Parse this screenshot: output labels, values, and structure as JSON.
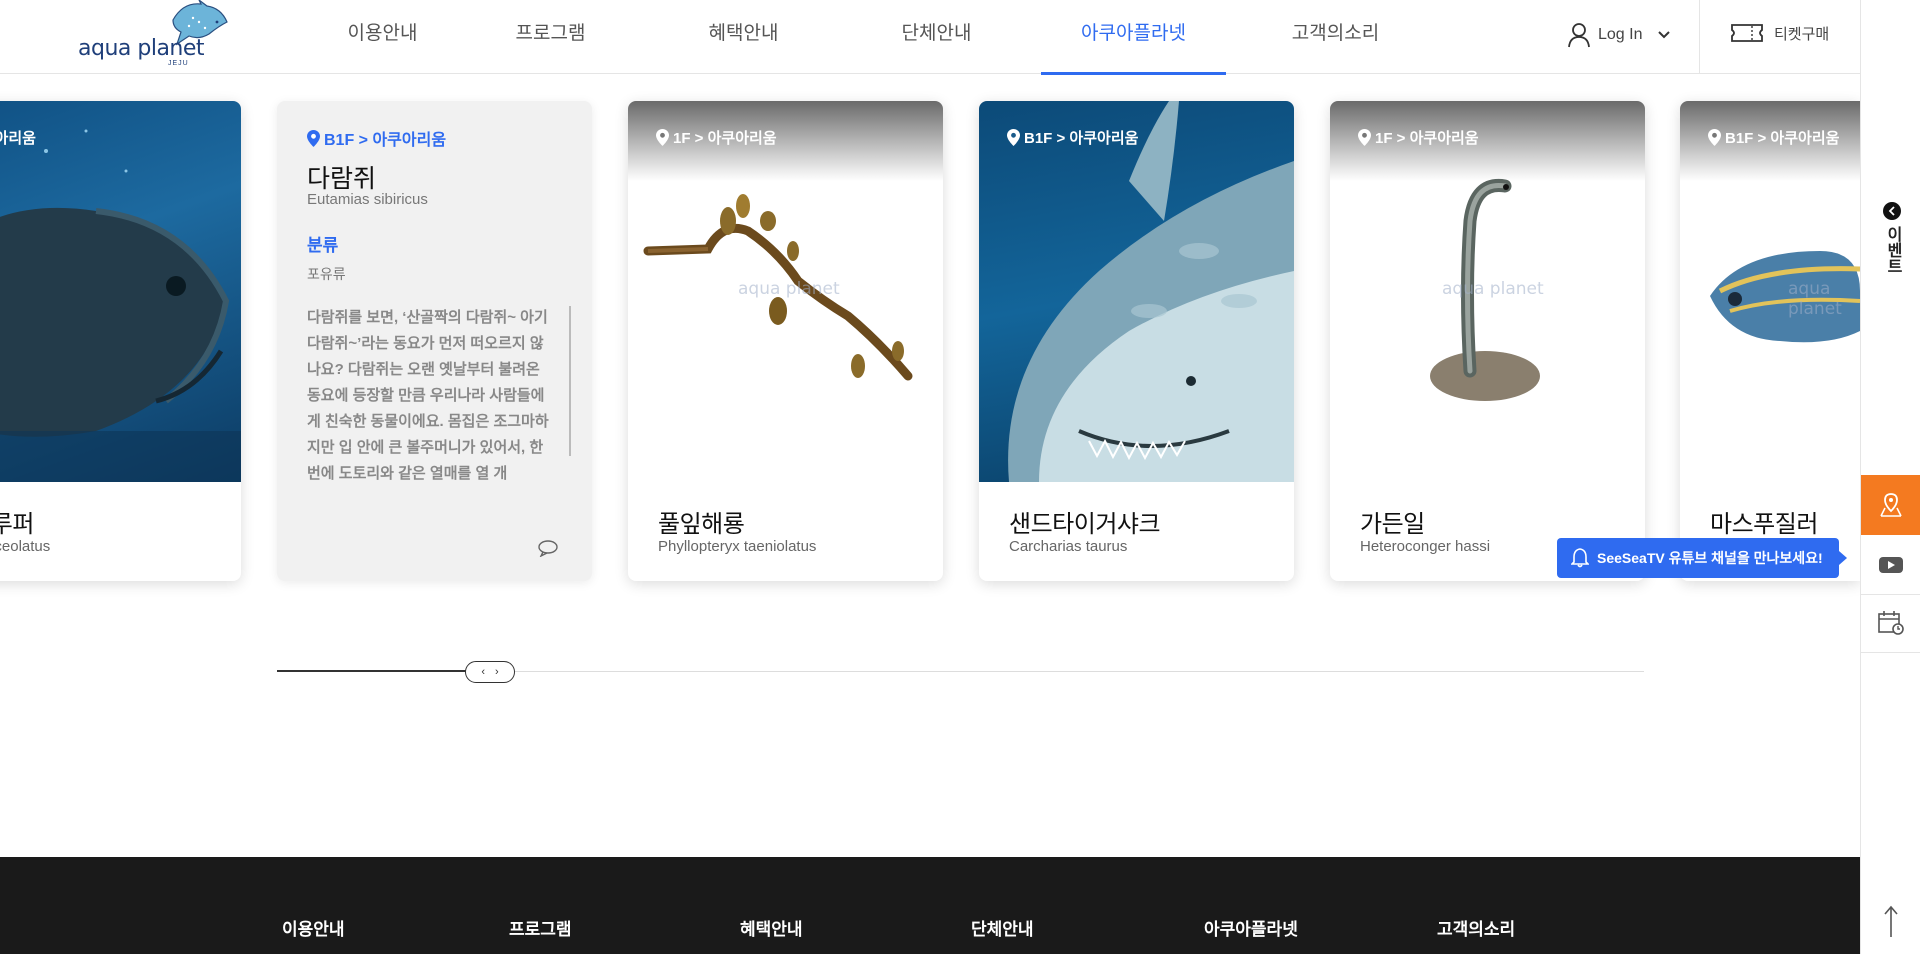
{
  "header": {
    "logo": {
      "text": "aqua planet",
      "sub": "JEJU"
    },
    "nav": [
      {
        "label": "이용안내"
      },
      {
        "label": "프로그램"
      },
      {
        "label": "혜택안내"
      },
      {
        "label": "단체안내"
      },
      {
        "label": "아쿠아플라넷",
        "active": true
      },
      {
        "label": "고객의소리"
      }
    ],
    "login_label": "Log In",
    "ticket_label": "티켓구매"
  },
  "cards": [
    {
      "location": "> 아쿠아리움",
      "name": "언트그루퍼",
      "scientific": "phelus lanceolatus"
    },
    {
      "location": "1F > 아쿠아리움",
      "name": "풀잎해룡",
      "scientific": "Phyllopteryx taeniolatus"
    },
    {
      "location": "B1F > 아쿠아리움",
      "name": "샌드타이거샤크",
      "scientific": "Carcharias taurus"
    },
    {
      "location": "1F > 아쿠아리움",
      "name": "가든일",
      "scientific": "Heteroconger hassi"
    },
    {
      "location": "B1F > 아쿠아리움",
      "name": "마스푸질러",
      "scientific": ""
    }
  ],
  "detail_card": {
    "location": "B1F > 아쿠아리움",
    "name": "다람쥐",
    "scientific": "Eutamias sibiricus",
    "classification_label": "분류",
    "classification_value": "포유류",
    "description": "다람쥐를 보면, ‘산골짝의 다람쥐~ 아기 다람쥐~’라는 동요가 먼저 떠오르지 않나요? 다람쥐는 오랜 옛날부터 불려온 동요에 등장할 만큼 우리나라 사람들에게 친숙한 동물이에요. 몸집은 조그마하지만 입 안에 큰 볼주머니가 있어서, 한 번에 도토리와 같은 열매를 열 개"
  },
  "watermark": "aqua planet",
  "sidebar": {
    "event_label": "이벤트"
  },
  "youtube_tooltip": "SeeSeaTV 유튜브 채널을 만나보세요!",
  "footer": {
    "nav": [
      "이용안내",
      "프로그램",
      "혜택안내",
      "단체안내",
      "아쿠아플라넷",
      "고객의소리"
    ]
  },
  "colors": {
    "accent": "#2f6bf0",
    "orange": "#f47a20",
    "footer_bg": "#1a1a1a"
  }
}
